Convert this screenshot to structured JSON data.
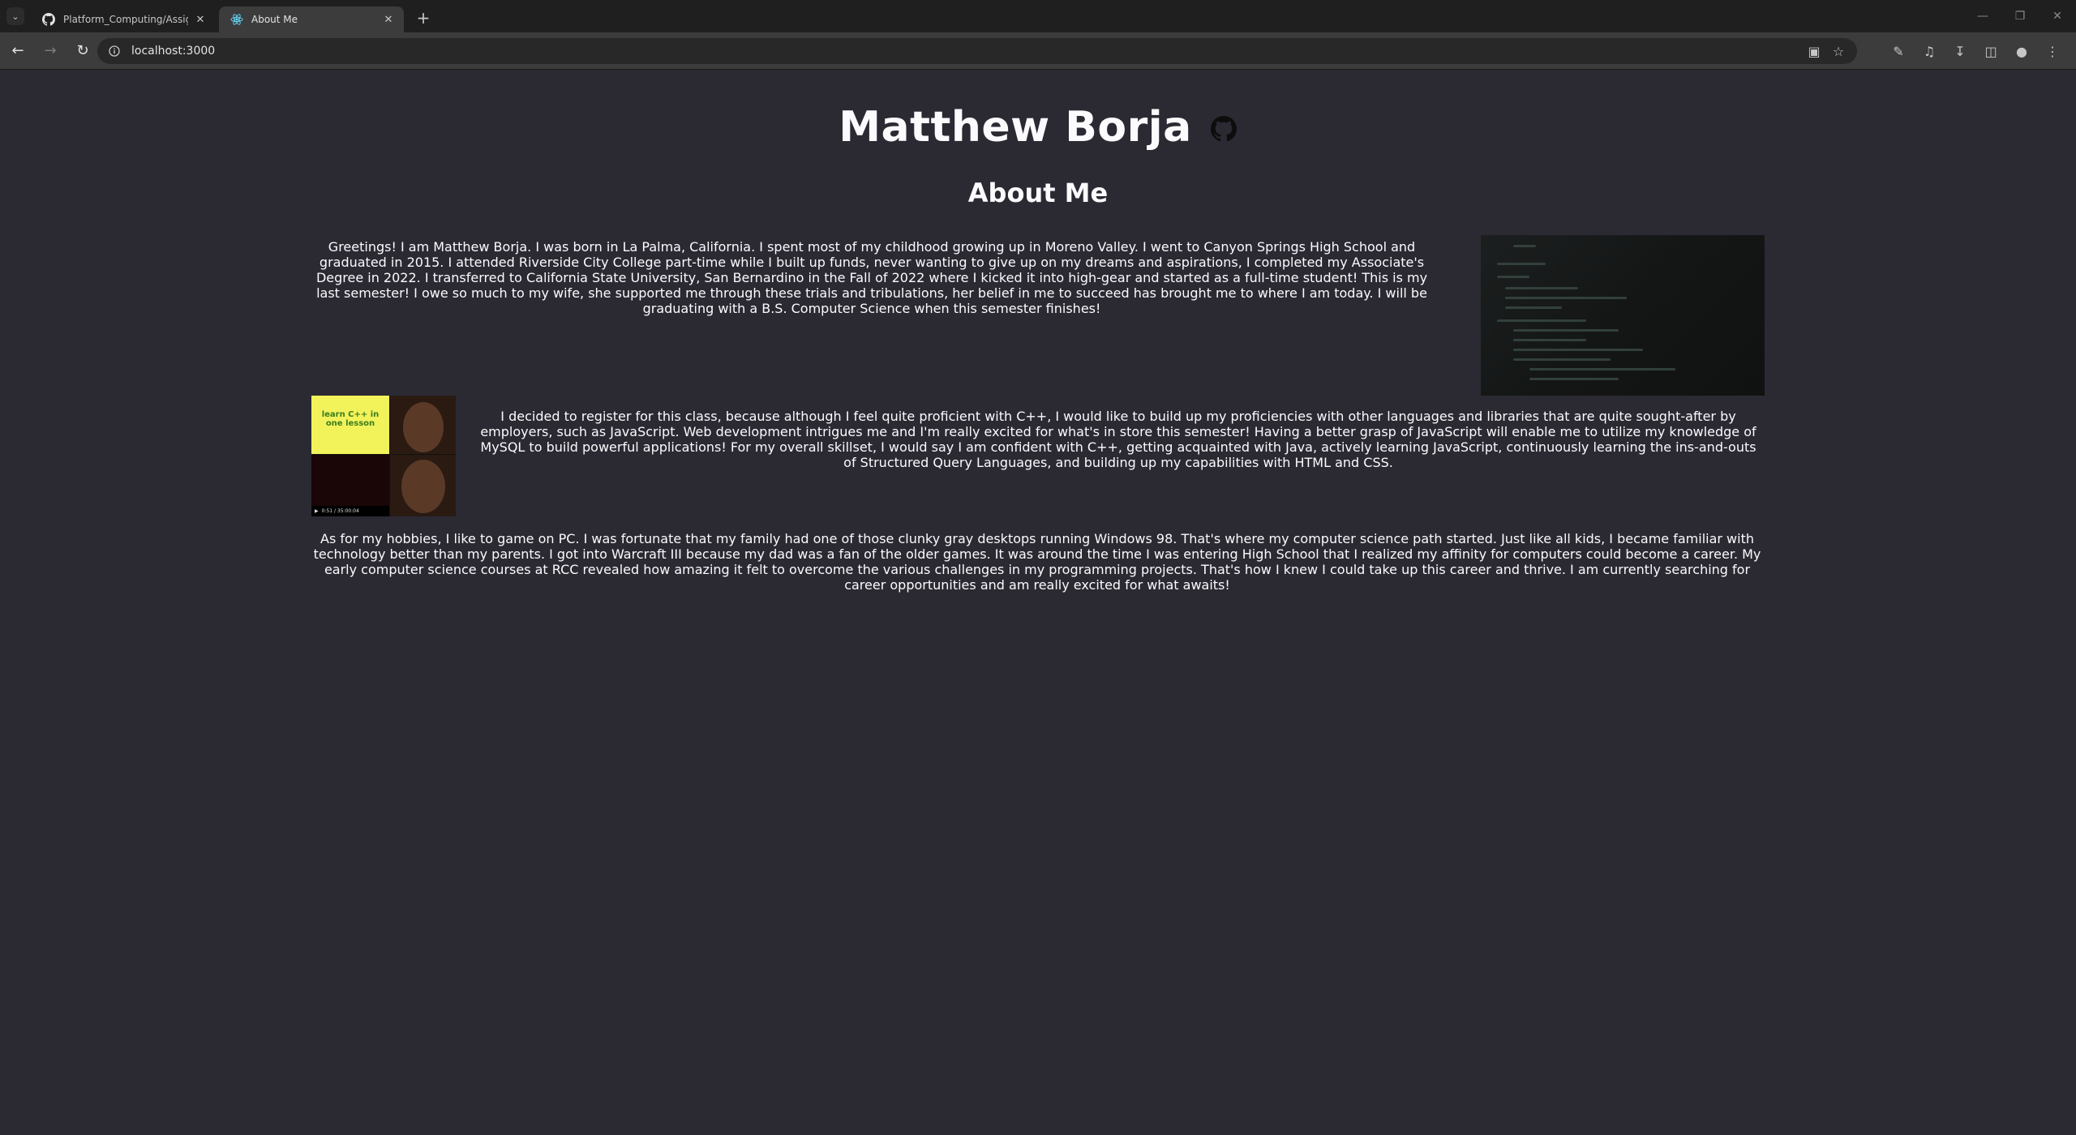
{
  "browser": {
    "tabs": [
      {
        "title": "Platform_Computing/Assignme",
        "favicon": "github-icon",
        "active": false
      },
      {
        "title": "About Me",
        "favicon": "react-icon",
        "active": true
      }
    ],
    "url": "localhost:3000"
  },
  "page": {
    "name": "Matthew Borja",
    "github_icon": "github-icon",
    "subtitle": "About Me",
    "paragraphs": [
      "Greetings! I am Matthew Borja. I was born in La Palma, California. I spent most of my childhood growing up in Moreno Valley. I went to Canyon Springs High School and graduated in 2015. I attended Riverside City College part-time while I built up funds, never wanting to give up on my dreams and aspirations, I completed my Associate's Degree in 2022. I transferred to California State University, San Bernardino in the Fall of 2022 where I kicked it into high-gear and started as a full-time student! This is my last semester! I owe so much to my wife, she supported me through these trials and tribulations, her belief in me to succeed has brought me to where I am today. I will be graduating with a B.S. Computer Science when this semester finishes!",
      "I decided to register for this class, because although I feel quite proficient with C++, I would like to build up my proficiencies with other languages and libraries that are quite sought-after by employers, such as JavaScript. Web development intrigues me and I'm really excited for what's in store this semester! Having a better grasp of JavaScript will enable me to utilize my knowledge of MySQL to build powerful applications! For my overall skillset, I would say I am confident with C++, getting acquainted with Java, actively learning JavaScript, continuously learning the ins-and-outs of Structured Query Languages, and building up my capabilities with HTML and CSS.",
      "As for my hobbies, I like to game on PC. I was fortunate that my family had one of those clunky gray desktops running Windows 98. That's where my computer science path started. Just like all kids, I became familiar with technology better than my parents. I got into Warcraft III because my dad was a fan of the older games. It was around the time I was entering High School that I realized my affinity for computers could become a career. My early computer science courses at RCC revealed how amazing it felt to overcome the various challenges in my programming projects. That's how I knew I could take up this career and thrive. I am currently searching for career opportunities and am really excited for what awaits!"
    ],
    "meme_text": "learn C++ in one lesson",
    "player_time": "0:51 / 35:00:04"
  }
}
